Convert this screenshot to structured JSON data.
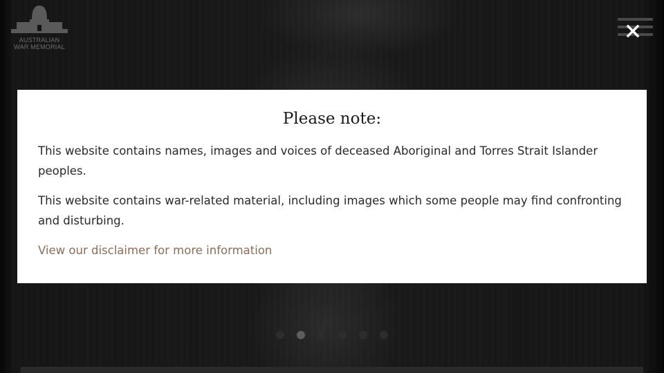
{
  "site": {
    "logo_line1": "AUSTRALIAN",
    "logo_line2": "WAR MEMORIAL"
  },
  "header": {
    "menu_icon": "hamburger-icon",
    "close_icon": "close-icon"
  },
  "modal": {
    "title": "Please note:",
    "paragraph1": "This website contains names, images and voices of deceased Aboriginal and Torres Strait Islander peoples.",
    "paragraph2": "This website contains war-related material, including images which some people may find confronting and disturbing.",
    "link_text": "View our disclaimer for more information"
  },
  "carousel": {
    "slide_count": 6,
    "active_index": 1
  },
  "colors": {
    "link": "#8c6d57",
    "modal_background": "#ffffff",
    "overlay": "#0c0c0c"
  }
}
